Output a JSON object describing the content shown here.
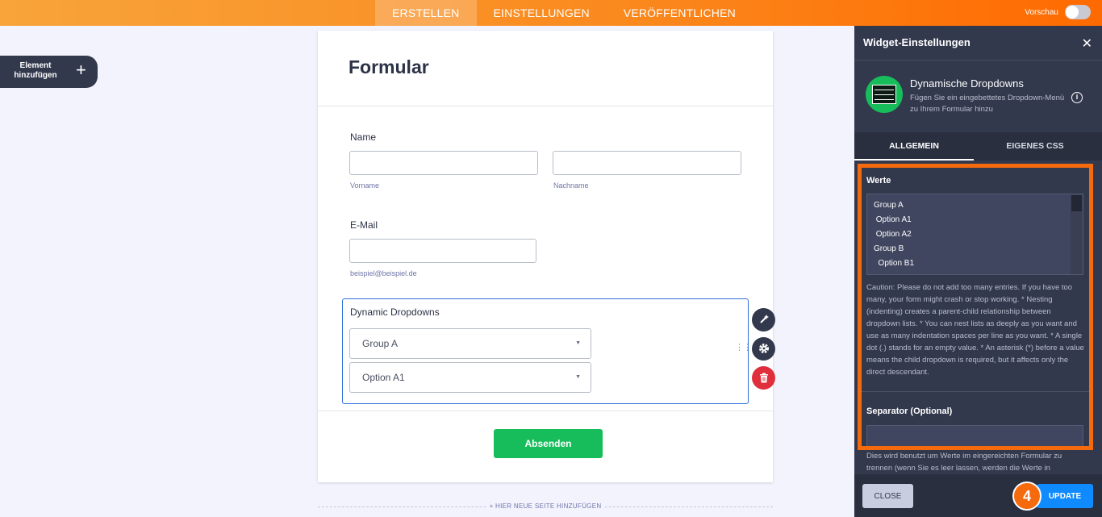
{
  "topbar": {
    "tabs": [
      "ERSTELLEN",
      "EINSTELLUNGEN",
      "VERÖFFENTLICHEN"
    ],
    "active_tab": "ERSTELLEN",
    "preview_label": "Vorschau"
  },
  "add_element": {
    "label": "Element hinzufügen",
    "icon": "plus-icon"
  },
  "form": {
    "title": "Formular",
    "name_label": "Name",
    "first_name_sub": "Vorname",
    "last_name_sub": "Nachname",
    "email_label": "E-Mail",
    "email_sub": "beispiel@beispiel.de",
    "dropdown_label": "Dynamic Dropdowns",
    "dropdown1_value": "Group A",
    "dropdown2_value": "Option A1",
    "submit_label": "Absenden",
    "add_page_label": "+ HIER NEUE SEITE HINZUFÜGEN"
  },
  "panel": {
    "title": "Widget-Einstellungen",
    "widget_name": "Dynamische Dropdowns",
    "widget_desc": "Fügen Sie ein eingebettetes Dropdown-Menü zu Ihrem Formular hinzu",
    "tabs": [
      "ALLGEMEIN",
      "EIGENES CSS"
    ],
    "values_label": "Werte",
    "values_lines": [
      "Group A",
      " Option A1",
      " Option A2",
      "Group B",
      "  Option B1"
    ],
    "caution": "Caution: Please do not add too many entries. If you have too many, your form might crash or stop working. * Nesting (indenting) creates a parent-child relationship between dropdown lists. * You can nest lists as deeply as you want and use as many indentation spaces per line as you want. * A single dot (.) stands for an empty value. * An asterisk (*) before a value means the child dropdown is required, but it affects only the direct descendant.",
    "separator_label": "Separator (Optional)",
    "separator_value": "",
    "separator_desc": "Dies wird benutzt um Werte im eingereichten Formular zu trennen (wenn Sie es leer lassen, werden die Werte in",
    "close_label": "CLOSE",
    "update_label": "UPDATE",
    "step_number": "4"
  },
  "colors": {
    "accent_orange": "#f66a0e",
    "submit_green": "#18bd5b",
    "update_blue": "#0f8aff",
    "panel_bg": "#33394d"
  }
}
